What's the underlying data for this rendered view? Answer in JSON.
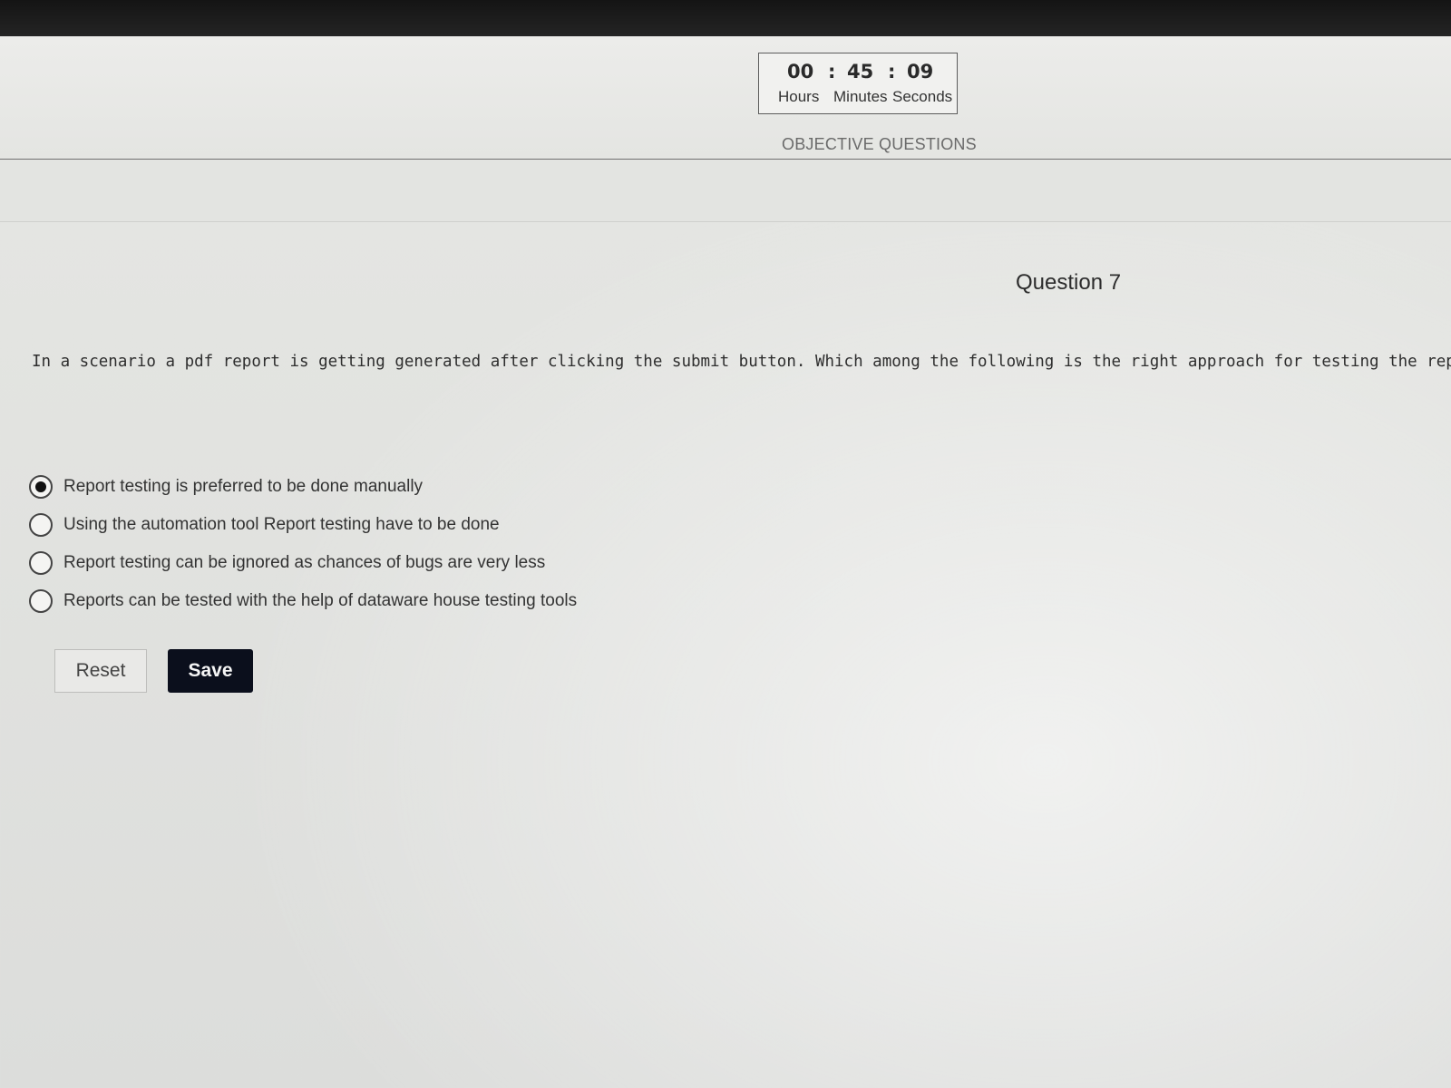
{
  "timer": {
    "hours": "00",
    "minutes": "45",
    "seconds": "09",
    "separator": ":",
    "hours_label": "Hours",
    "minutes_label": "Minutes",
    "seconds_label": "Seconds"
  },
  "section": {
    "label": "OBJECTIVE QUESTIONS"
  },
  "question": {
    "title": "Question 7",
    "text": "In a scenario a pdf report is getting generated after clicking the submit button. Which among the following is the right approach for testing the report?"
  },
  "options": [
    {
      "label": "Report testing is preferred to be done manually",
      "selected": true
    },
    {
      "label": "Using the automation tool Report testing have to be done",
      "selected": false
    },
    {
      "label": "Report testing can be ignored as chances of bugs are very less",
      "selected": false
    },
    {
      "label": "Reports can be tested with the help of dataware house testing tools",
      "selected": false
    }
  ],
  "actions": {
    "reset_label": "Reset",
    "save_label": "Save"
  }
}
